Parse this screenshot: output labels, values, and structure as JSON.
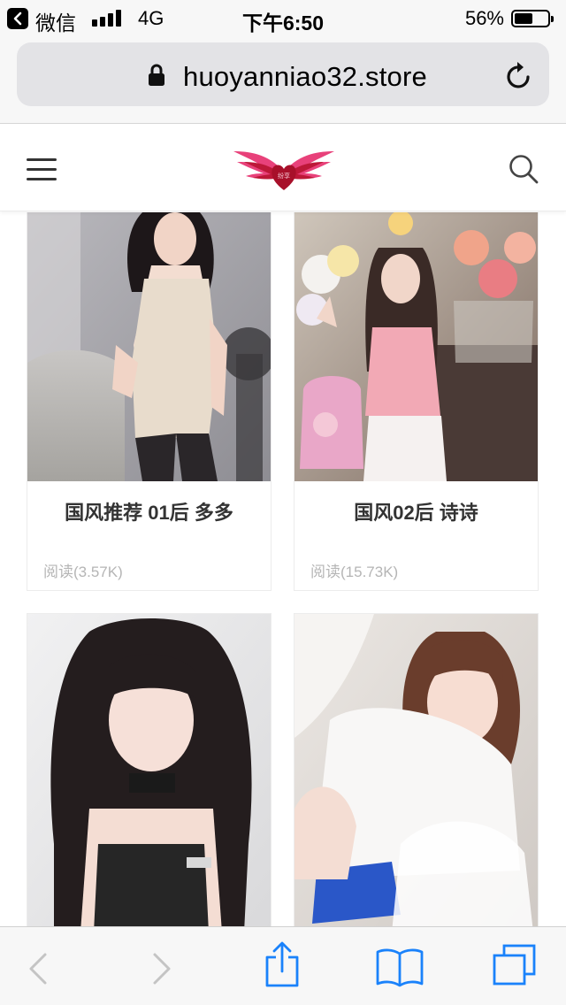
{
  "status_bar": {
    "app_name": "微信",
    "network": "4G",
    "time": "下午6:50",
    "battery_percent": "56%",
    "battery_level": 0.56,
    "signal_bars": 4
  },
  "address_bar": {
    "url": "huoyanniao32.store",
    "secure": true
  },
  "site_header": {
    "logo_text": "纷享",
    "menu_icon": "hamburger-menu-icon",
    "search_icon": "search-icon"
  },
  "cards": [
    {
      "title": "国风推荐 01后 多多",
      "reads": "阅读(3.57K)"
    },
    {
      "title": "国风02后 诗诗",
      "reads": "阅读(15.73K)"
    },
    {
      "title": "",
      "reads": ""
    },
    {
      "title": "",
      "reads": ""
    }
  ],
  "toolbar": {
    "icons": [
      "back-arrow-icon",
      "forward-arrow-icon",
      "share-icon",
      "bookmarks-icon",
      "tabs-icon"
    ]
  },
  "colors": {
    "ios_blue": "#1a82fb",
    "disabled_gray": "#c4c4c4",
    "logo_pink": "#e8417a",
    "logo_red": "#b5122d"
  }
}
